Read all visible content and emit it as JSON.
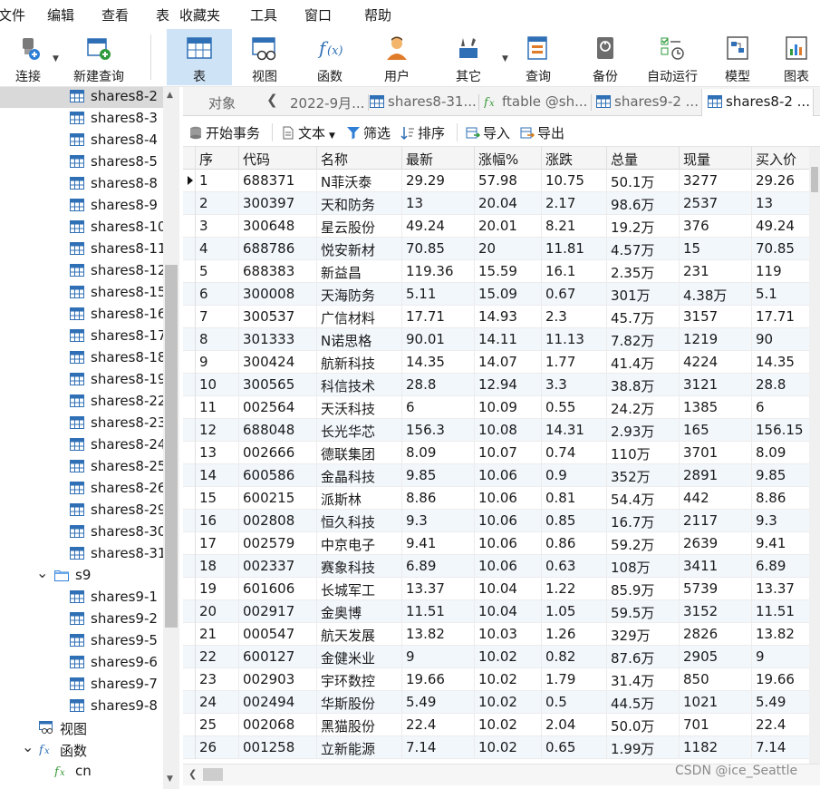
{
  "menu": [
    "文件",
    "编辑",
    "查看",
    "表",
    "收藏夹",
    "工具",
    "窗口",
    "帮助"
  ],
  "toolbar": [
    {
      "label": "连接",
      "icon": "connect-icon",
      "dropdown": true
    },
    {
      "label": "新建查询",
      "icon": "new-query-icon",
      "dropdown": false
    },
    {
      "label": "表",
      "icon": "table-icon",
      "dropdown": false
    },
    {
      "label": "视图",
      "icon": "view-icon",
      "dropdown": false
    },
    {
      "label": "函数",
      "icon": "function-icon",
      "dropdown": false
    },
    {
      "label": "用户",
      "icon": "user-icon",
      "dropdown": false
    },
    {
      "label": "其它",
      "icon": "tools-icon",
      "dropdown": true
    },
    {
      "label": "查询",
      "icon": "query-icon",
      "dropdown": false
    },
    {
      "label": "备份",
      "icon": "backup-icon",
      "dropdown": false
    },
    {
      "label": "自动运行",
      "icon": "auto-run-icon",
      "dropdown": false
    },
    {
      "label": "模型",
      "icon": "model-icon",
      "dropdown": false
    },
    {
      "label": "图表",
      "icon": "chart-icon",
      "dropdown": false
    }
  ],
  "sidebar": {
    "tables8": [
      "shares8-2",
      "shares8-3",
      "shares8-4",
      "shares8-5",
      "shares8-8",
      "shares8-9",
      "shares8-10",
      "shares8-11",
      "shares8-12",
      "shares8-15",
      "shares8-16",
      "shares8-17",
      "shares8-18",
      "shares8-19",
      "shares8-22",
      "shares8-23",
      "shares8-24",
      "shares8-25",
      "shares8-26",
      "shares8-29",
      "shares8-30",
      "shares8-31"
    ],
    "folder": "s9",
    "tables9": [
      "shares9-1",
      "shares9-2",
      "shares9-5",
      "shares9-6",
      "shares9-7",
      "shares9-8"
    ],
    "views_label": "视图",
    "functions_label": "函数",
    "function_item": "cn"
  },
  "tabs": {
    "objects": "对象",
    "items": [
      {
        "label": "2022-9月...",
        "icon": "none"
      },
      {
        "label": "shares8-31...",
        "icon": "table-icon"
      },
      {
        "label": "ftable @sh...",
        "icon": "function-icon"
      },
      {
        "label": "shares9-2 ...",
        "icon": "table-icon"
      },
      {
        "label": "shares8-2 ...",
        "icon": "table-icon"
      }
    ]
  },
  "subtoolbar": {
    "begin_tx": "开始事务",
    "text": "文本",
    "filter": "筛选",
    "sort": "排序",
    "import": "导入",
    "export": "导出"
  },
  "grid": {
    "columns": [
      "序",
      "代码",
      "名称",
      "最新",
      "涨幅%",
      "涨跌",
      "总量",
      "现量",
      "买入价"
    ],
    "rows": [
      [
        "1",
        "688371",
        "N菲沃泰",
        "29.29",
        "57.98",
        "10.75",
        "50.1万",
        "3277",
        "29.26"
      ],
      [
        "2",
        "300397",
        "天和防务",
        "13",
        "20.04",
        "2.17",
        "98.6万",
        "2537",
        "13"
      ],
      [
        "3",
        "300648",
        "星云股份",
        "49.24",
        "20.01",
        "8.21",
        "19.2万",
        "376",
        "49.24"
      ],
      [
        "4",
        "688786",
        "悦安新材",
        "70.85",
        "20",
        "11.81",
        "4.57万",
        "15",
        "70.85"
      ],
      [
        "5",
        "688383",
        "新益昌",
        "119.36",
        "15.59",
        "16.1",
        "2.35万",
        "231",
        "119"
      ],
      [
        "6",
        "300008",
        "天海防务",
        "5.11",
        "15.09",
        "0.67",
        "301万",
        " 4.38万",
        "5.1"
      ],
      [
        "7",
        "300537",
        "广信材料",
        "17.71",
        "14.93",
        "2.3",
        "45.7万",
        "3157",
        "17.71"
      ],
      [
        "8",
        "301333",
        "N诺思格",
        "90.01",
        "14.11",
        "11.13",
        "7.82万",
        "1219",
        "90"
      ],
      [
        "9",
        "300424",
        "航新科技",
        "14.35",
        "14.07",
        "1.77",
        "41.4万",
        "4224",
        "14.35"
      ],
      [
        "10",
        "300565",
        "科信技术",
        "28.8",
        "12.94",
        "3.3",
        "38.8万",
        "3121",
        "28.8"
      ],
      [
        "11",
        "002564",
        "天沃科技",
        "6",
        "10.09",
        "0.55",
        "24.2万",
        "1385",
        "6"
      ],
      [
        "12",
        "688048",
        "长光华芯",
        "156.3",
        "10.08",
        "14.31",
        "2.93万",
        "165",
        "156.15"
      ],
      [
        "13",
        "002666",
        "德联集团",
        "8.09",
        "10.07",
        "0.74",
        "110万",
        "3701",
        "8.09"
      ],
      [
        "14",
        "600586",
        "金晶科技",
        "9.85",
        "10.06",
        "0.9",
        "352万",
        "2891",
        "9.85"
      ],
      [
        "15",
        "600215",
        "派斯林",
        "8.86",
        "10.06",
        "0.81",
        "54.4万",
        "442",
        "8.86"
      ],
      [
        "16",
        "002808",
        "恒久科技",
        "9.3",
        "10.06",
        "0.85",
        "16.7万",
        "2117",
        "9.3"
      ],
      [
        "17",
        "002579",
        "中京电子",
        "9.41",
        "10.06",
        "0.86",
        "59.2万",
        "2639",
        "9.41"
      ],
      [
        "18",
        "002337",
        "赛象科技",
        "6.89",
        "10.06",
        "0.63",
        "108万",
        "3411",
        "6.89"
      ],
      [
        "19",
        "601606",
        "长城军工",
        "13.37",
        "10.04",
        "1.22",
        "85.9万",
        "5739",
        "13.37"
      ],
      [
        "20",
        "002917",
        "金奥博",
        "11.51",
        "10.04",
        "1.05",
        "59.5万",
        "3152",
        "11.51"
      ],
      [
        "21",
        "000547",
        "航天发展",
        "13.82",
        "10.03",
        "1.26",
        "329万",
        "2826",
        "13.82"
      ],
      [
        "22",
        "600127",
        "金健米业",
        "9",
        "10.02",
        "0.82",
        "87.6万",
        "2905",
        "9"
      ],
      [
        "23",
        "002903",
        "宇环数控",
        "19.66",
        "10.02",
        "1.79",
        "31.4万",
        "850",
        "19.66"
      ],
      [
        "24",
        "002494",
        "华斯股份",
        "5.49",
        "10.02",
        "0.5",
        "44.5万",
        "1021",
        "5.49"
      ],
      [
        "25",
        "002068",
        "黑猫股份",
        "22.4",
        "10.02",
        "2.04",
        "50.0万",
        "701",
        "22.4"
      ],
      [
        "26",
        "001258",
        "立新能源",
        "7.14",
        "10.02",
        "0.65",
        "1.99万",
        "1182",
        "7.14"
      ]
    ]
  },
  "watermark": "CSDN @ice_Seattle",
  "colors": {
    "active_tool": "#cfe3f7",
    "table_icon": "#2f6fb5",
    "alt_row": "#f2f7fc",
    "selection": "#d9d9d9"
  }
}
